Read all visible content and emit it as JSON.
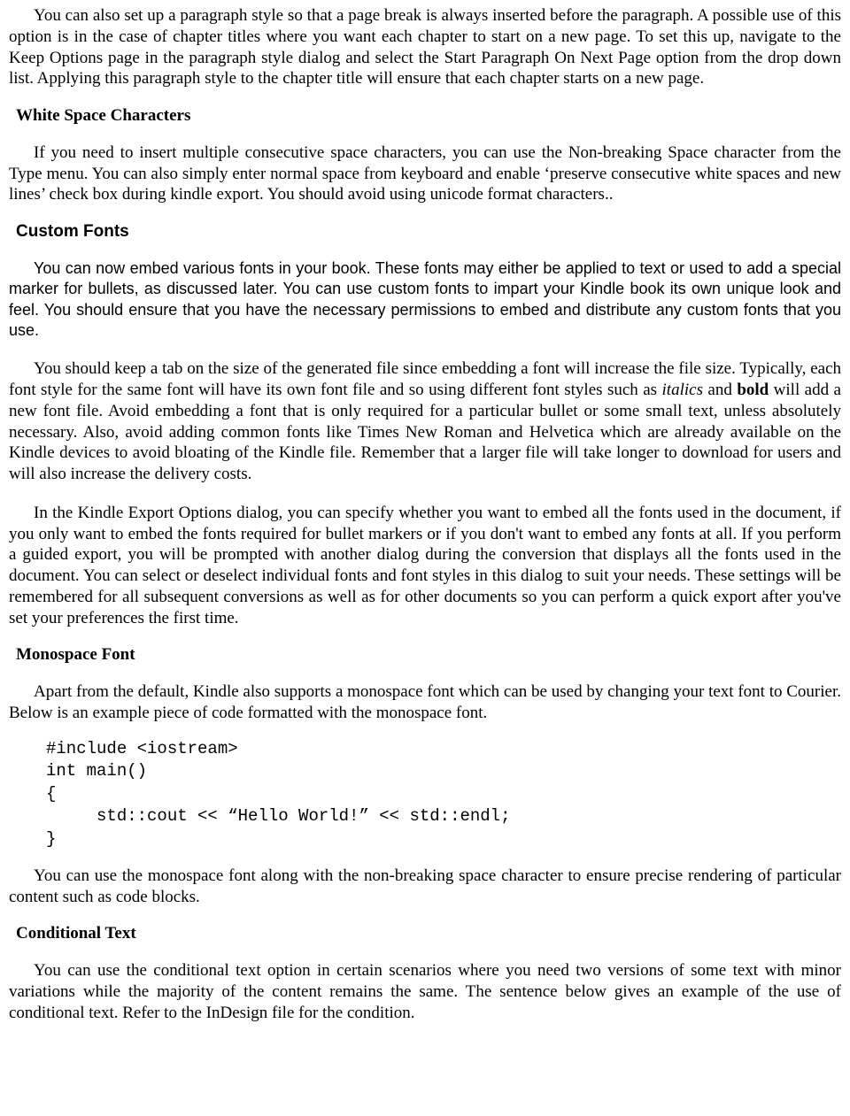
{
  "para_intro": "You can also set up a paragraph style so that a page break is always inserted before the paragraph. A possible use of this option is in the case of chapter titles where you want each chapter to start on a new page. To set this up, navigate to the Keep Options page in the paragraph style dialog and select the Start Paragraph On Next Page option from the drop down list. Applying this paragraph style to the chapter title will ensure that each chapter starts on a new page.",
  "whitespace": {
    "heading": "White Space Characters",
    "para": "If you need to insert multiple consecutive space characters, you can use the Non-breaking Space character from the Type menu. You can also simply enter normal space from keyboard and enable ‘preserve consecutive white spaces and new lines’ check box during kindle export.  You should avoid using unicode format characters.."
  },
  "customfonts": {
    "heading": "Custom Fonts",
    "para1": "You can now embed various fonts in your book. These fonts may either be applied to text or used to add a special marker for bullets, as discussed later. You can use custom fonts to impart your Kindle book its own unique look and feel. You should ensure that you have the necessary permissions to embed and distribute any custom fonts that you use.",
    "para2_a": "You should keep a tab on the size of the generated file since embedding a font will increase the file size. Typically, each font style for the same font will have its own font file and so using different font styles such as ",
    "para2_italics": "italics",
    "para2_b": " and ",
    "para2_bold": "bold",
    "para2_c": " will add a new font file. Avoid embedding a font that is only required for a particular bullet or some small text, unless absolutely necessary. Also, avoid adding common fonts like Times New Roman and Helvetica which are already available on the Kindle devices to avoid bloating of the Kindle file. Remember that a larger file will take longer to download for users and will also increase the delivery costs.",
    "para3": "In the Kindle Export Options dialog, you can specify whether you want to embed all the fonts used in the document, if you only want to embed the fonts required for bullet markers or if you don't want to embed any fonts at all. If you perform a guided export, you will be prompted with another dialog during the conversion that displays all the fonts used in the document. You can select or deselect individual fonts and font styles in this dialog to suit your needs. These settings will be remembered for all subsequent conversions as well as for other documents so you can perform a quick export after you've set your preferences the first time."
  },
  "monospace": {
    "heading": "Monospace Font",
    "para1": "Apart from the default, Kindle also supports a monospace font which can be used by changing your text font to Courier. Below is an example piece of code formatted with the monospace font.",
    "code": "#include <iostream>\nint main()\n{\n     std::cout << “Hello World!” << std::endl;\n}",
    "para2": "You can use the monospace font along with the non-breaking space character to ensure precise rendering of particular content such as code blocks."
  },
  "conditional": {
    "heading": "Conditional Text",
    "para": "You can use the conditional text option in certain scenarios where you need two versions of some text with minor variations while the majority of the content remains the same. The sentence below gives an example of the use of conditional text. Refer to the InDesign file for the condition."
  }
}
